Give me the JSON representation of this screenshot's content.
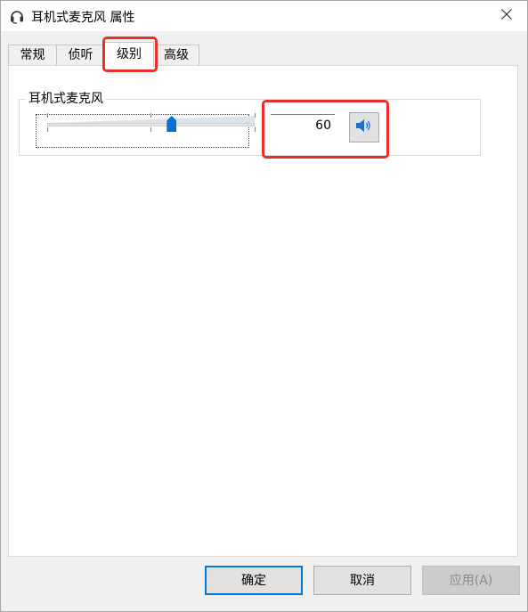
{
  "window": {
    "title": "耳机式麦克风 属性"
  },
  "tabs": [
    {
      "label": "常规"
    },
    {
      "label": "侦听"
    },
    {
      "label": "级别"
    },
    {
      "label": "高级"
    }
  ],
  "levels": {
    "group_label": "耳机式麦克风",
    "volume_value": "60",
    "volume_level": 0.6
  },
  "buttons": {
    "ok": "确定",
    "cancel": "取消",
    "apply": "应用(A)"
  },
  "colors": {
    "accent": "#0078d7",
    "highlight": "#e8302a"
  },
  "icons": {
    "title": "headset-icon",
    "close": "close-icon",
    "speaker": "speaker-icon"
  }
}
